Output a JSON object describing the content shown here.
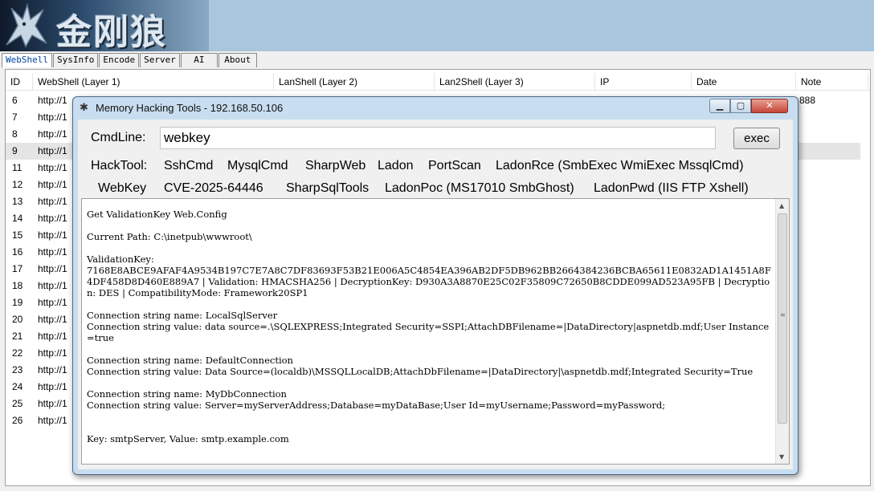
{
  "tabs": [
    "WebShell",
    "SysInfo",
    "Encode",
    "Server",
    "AI",
    "About"
  ],
  "logo_text": "金刚狼",
  "columns": [
    "ID",
    "WebShell (Layer 1)",
    "LanShell (Layer 2)",
    "Lan2Shell (Layer 3)",
    "IP",
    "Date",
    "Note"
  ],
  "rows": [
    {
      "id": "6",
      "url": "http://1",
      "note": "888"
    },
    {
      "id": "7",
      "url": "http://1",
      "note": ""
    },
    {
      "id": "8",
      "url": "http://1",
      "note": ""
    },
    {
      "id": "9",
      "url": "http://1",
      "note": ""
    },
    {
      "id": "11",
      "url": "http://1",
      "note": ""
    },
    {
      "id": "12",
      "url": "http://1",
      "note": ""
    },
    {
      "id": "13",
      "url": "http://1",
      "note": ""
    },
    {
      "id": "14",
      "url": "http://1",
      "note": ""
    },
    {
      "id": "15",
      "url": "http://1",
      "note": ""
    },
    {
      "id": "16",
      "url": "http://1",
      "note": ""
    },
    {
      "id": "17",
      "url": "http://1",
      "note": ""
    },
    {
      "id": "18",
      "url": "http://1",
      "note": ""
    },
    {
      "id": "19",
      "url": "http://1",
      "note": ""
    },
    {
      "id": "20",
      "url": "http://1",
      "note": ""
    },
    {
      "id": "21",
      "url": "http://1",
      "note": ""
    },
    {
      "id": "22",
      "url": "http://1",
      "note": ""
    },
    {
      "id": "23",
      "url": "http://1",
      "note": ""
    },
    {
      "id": "24",
      "url": "http://1",
      "note": ""
    },
    {
      "id": "25",
      "url": "http://1",
      "note": ""
    },
    {
      "id": "26",
      "url": "http://1",
      "note": ""
    }
  ],
  "dialog": {
    "title": "Memory Hacking Tools - 192.168.50.106",
    "cmd_label": "CmdLine:",
    "cmd_value": "webkey",
    "exec_label": "exec",
    "hacktool_label": "HackTool:",
    "tools_row1": [
      "SshCmd",
      "MysqlCmd",
      "SharpWeb",
      "Ladon",
      "PortScan",
      "LadonRce (SmbExec WmiExec MssqlCmd)"
    ],
    "tools_row2": [
      "WebKey",
      "CVE-2025-64446",
      "SharpSqlTools",
      "LadonPoc (MS17010 SmbGhost)",
      "LadonPwd (IIS FTP Xshell)"
    ],
    "output": "Get ValidationKey Web.Config\n\nCurrent Path: C:\\inetpub\\wwwroot\\\n\nValidationKey:\n7168E8ABCE9AFAF4A9534B197C7E7A8C7DF83693F53B21E006A5C4854EA396AB2DF5DB962BB2664384236BCBA65611E0832AD1A1451A8F4DF458D8D460E889A7 | Validation: HMACSHA256 | DecryptionKey: D930A3A8870E25C02F35809C72650B8CDDE099AD523A95FB | Decryption: DES | CompatibilityMode: Framework20SP1\n\nConnection string name: LocalSqlServer\nConnection string value: data source=.\\SQLEXPRESS;Integrated Security=SSPI;AttachDBFilename=|DataDirectory|aspnetdb.mdf;User Instance=true\n\nConnection string name: DefaultConnection\nConnection string value: Data Source=(localdb)\\MSSQLLocalDB;AttachDbFilename=|DataDirectory|\\aspnetdb.mdf;Integrated Security=True\n\nConnection string name: MyDbConnection\nConnection string value: Server=myServerAddress;Database=myDataBase;User Id=myUsername;Password=myPassword;\n\n\nKey: smtpServer, Value: smtp.example.com"
  },
  "colors": {
    "accent": "#0046a0",
    "banner": "#a9c6dd",
    "dialog_frame": "#c8ddef",
    "close": "#c6453a"
  }
}
